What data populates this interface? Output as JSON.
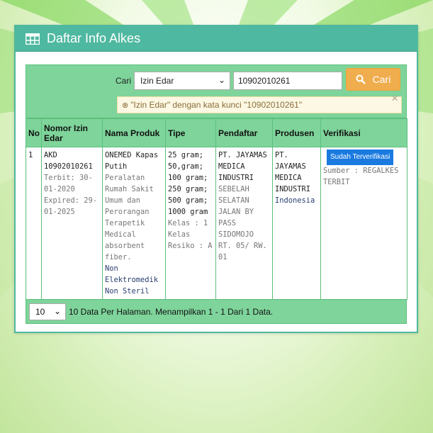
{
  "header": {
    "title": "Daftar Info Alkes",
    "icon": "table-icon"
  },
  "search": {
    "label": "Cari",
    "type_selected": "Izin Edar",
    "keyword_value": "10902010261",
    "button_label": "Cari",
    "alert_text": "\"Izin Edar\" dengan kata kunci \"10902010261\"",
    "close_symbol": "×"
  },
  "table": {
    "columns": [
      "No",
      "Nomor Izin Edar",
      "Nama Produk",
      "Tipe",
      "Pendaftar",
      "Produsen",
      "Verifikasi"
    ],
    "rows": [
      {
        "no": "1",
        "nomor_izin": "AKD 10902010261",
        "terbit": "Terbit: 30-01-2020",
        "expired": "Expired: 29-01-2025",
        "nama_produk": "ONEMED Kapas Putih",
        "deskripsi": "Peralatan Rumah Sakit Umum dan Perorangan Terapetik Medical absorbent fiber.",
        "kategori1": "Non Elektromedik",
        "kategori2": "Non Steril",
        "tipe": "25 gram; 50,gram; 100 gram; 250 gram; 500 gram; 1000 gram",
        "kelas": "Kelas : 1",
        "kelas_resiko": "Kelas Resiko : A",
        "pendaftar_nama": "PT. JAYAMAS MEDICA INDUSTRI",
        "pendaftar_alamat": "SEBELAH SELATAN JALAN BY PASS SIDOMOJO RT. 05/ RW. 01",
        "produsen_nama": "PT. JAYAMAS MEDICA INDUSTRI",
        "produsen_negara": "Indonesia",
        "verifikasi_badge": "Sudah Terverifikasi",
        "sumber": "Sumber : REGALKES TERBIT"
      }
    ]
  },
  "footer": {
    "per_page": "10",
    "summary": "10 Data Per Halaman. Menampilkan 1 - 1 Dari 1 Data."
  },
  "colors": {
    "header_bg": "#4fb8a0",
    "table_green": "#7ed49a",
    "button_orange": "#f0ad4e",
    "badge_blue": "#1a7ae0",
    "alert_bg": "#fcf8e3"
  }
}
